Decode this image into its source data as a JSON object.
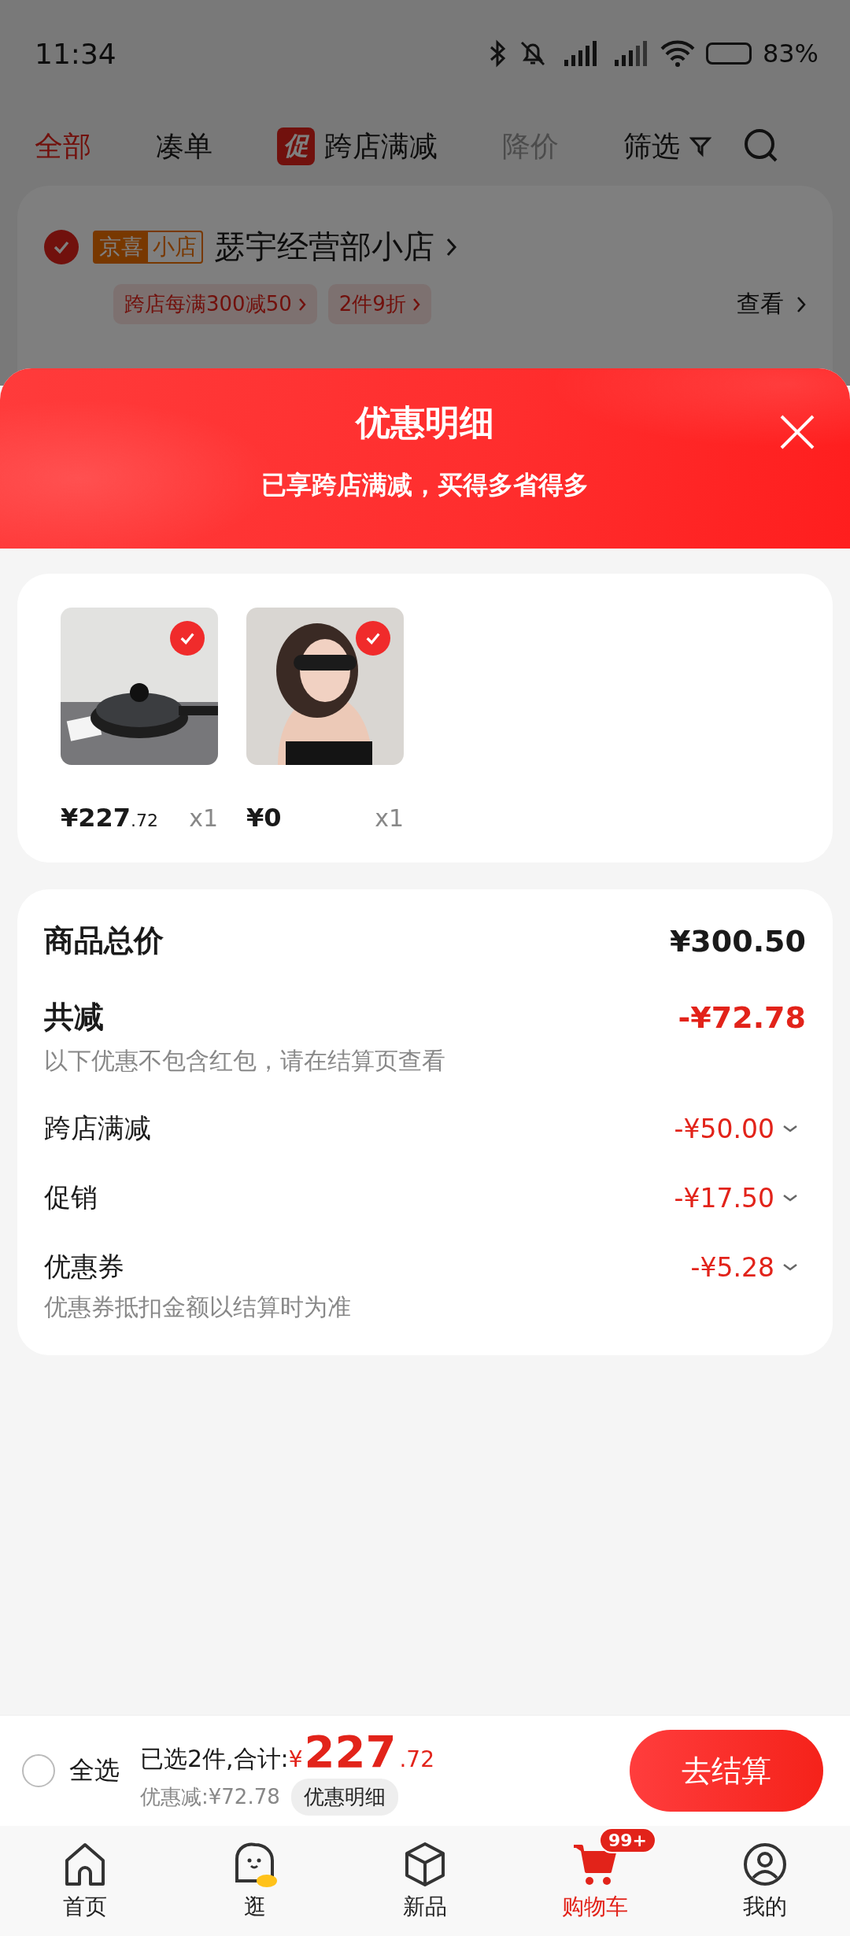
{
  "status_bar": {
    "time": "11:34",
    "battery": "83%"
  },
  "tabs": [
    {
      "label": "全部",
      "selected": true,
      "disabled": false
    },
    {
      "label": "凑单",
      "selected": false,
      "disabled": false
    },
    {
      "label": "跨店满减",
      "badge": "促",
      "selected": false,
      "disabled": false
    },
    {
      "label": "降价",
      "selected": false,
      "disabled": true
    }
  ],
  "filter": {
    "label": "筛选"
  },
  "store": {
    "checked": true,
    "tags": [
      "京喜",
      "小店"
    ],
    "name": "瑟宇经营部小店",
    "promos": [
      "跨店每满300减50",
      "2件9折"
    ],
    "view": "查看"
  },
  "sheet": {
    "title": "优惠明细",
    "subtitle": "已享跨店满减，买得多省得多",
    "items": [
      {
        "kind": "pan",
        "checked": true,
        "price": "¥227",
        "decimal": ".72",
        "qty": "x1"
      },
      {
        "kind": "person",
        "checked": true,
        "price": "¥0",
        "qty": "x1"
      }
    ],
    "total": {
      "label": "商品总价",
      "amount": "¥300.50"
    },
    "reduction": {
      "label": "共减",
      "amount": "-¥72.78",
      "note": "以下优惠不包含红包，请在结算页查看"
    },
    "discounts": [
      {
        "label": "跨店满减",
        "amount": "-¥50.00"
      },
      {
        "label": "促销",
        "amount": "-¥17.50"
      },
      {
        "label": "优惠券",
        "amount": "-¥5.28",
        "note": "优惠券抵扣金额以结算时为准"
      }
    ]
  },
  "checkout": {
    "select_all": {
      "label": "全选",
      "checked": false
    },
    "summary": "已选2件,合计:",
    "currency": "¥",
    "amount": "227",
    "decimal": ".72",
    "saved": "优惠减:¥72.78",
    "detail_button": "优惠明细",
    "button": "去结算"
  },
  "nav": [
    {
      "kind": "home",
      "label": "首页",
      "selected": false
    },
    {
      "kind": "explore",
      "label": "逛",
      "selected": false
    },
    {
      "kind": "new",
      "label": "新品",
      "selected": false
    },
    {
      "kind": "cart",
      "label": "购物车",
      "badge": "99+",
      "selected": true
    },
    {
      "kind": "me",
      "label": "我的",
      "selected": false
    }
  ]
}
